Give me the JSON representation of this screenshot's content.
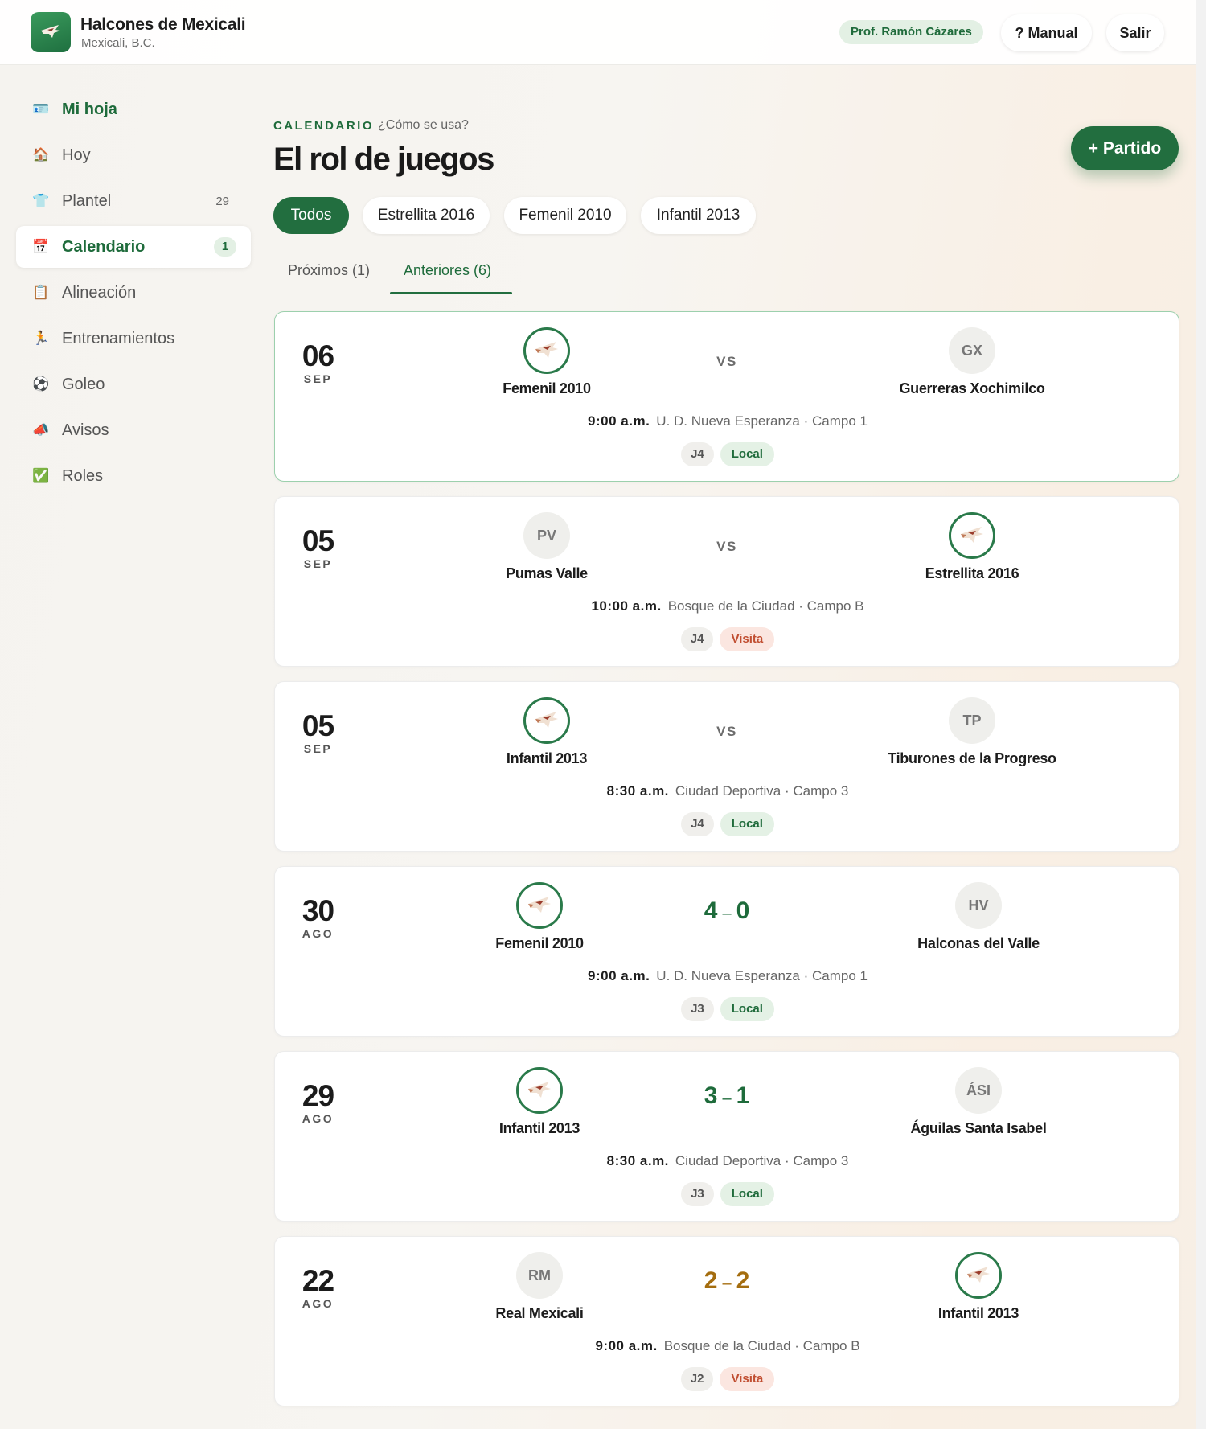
{
  "header": {
    "club_name": "Halcones de Mexicali",
    "club_city": "Mexicali, B.C.",
    "user": "Prof. Ramón Cázares",
    "manual_label": "Manual",
    "manual_icon": "?",
    "logout_label": "Salir"
  },
  "sidebar": {
    "items": [
      {
        "label": "Mi hoja",
        "icon": "id-card-icon",
        "glyph": "🪪"
      },
      {
        "label": "Hoy",
        "icon": "home-icon",
        "glyph": "🏠"
      },
      {
        "label": "Plantel",
        "icon": "shirt-icon",
        "glyph": "👕",
        "count": "29"
      },
      {
        "label": "Calendario",
        "icon": "calendar-icon",
        "glyph": "📅",
        "badge": "1"
      },
      {
        "label": "Alineación",
        "icon": "clipboard-icon",
        "glyph": "📋"
      },
      {
        "label": "Entrenamientos",
        "icon": "runner-icon",
        "glyph": "🏃"
      },
      {
        "label": "Goleo",
        "icon": "ball-icon",
        "glyph": "⚽"
      },
      {
        "label": "Avisos",
        "icon": "megaphone-icon",
        "glyph": "📣"
      },
      {
        "label": "Roles",
        "icon": "check-icon",
        "glyph": "✅"
      }
    ]
  },
  "page": {
    "eyebrow": "CALENDARIO",
    "help": "¿Cómo se usa?",
    "title": "El rol de juegos",
    "add_button": "+ Partido"
  },
  "filters": [
    "Todos",
    "Estrellita 2016",
    "Femenil 2010",
    "Infantil 2013"
  ],
  "tabs": [
    "Próximos (1)",
    "Anteriores (6)"
  ],
  "matches": [
    {
      "day": "06",
      "month": "SEP",
      "home": {
        "name": "Femenil 2010",
        "own": true
      },
      "away": {
        "name": "Guerreras Xochimilco",
        "initials": "GX"
      },
      "center": "VS",
      "time": "9:00 a.m.",
      "venue": "U. D. Nueva Esperanza · Campo 1",
      "round": "J4",
      "side": "Local"
    },
    {
      "day": "05",
      "month": "SEP",
      "home": {
        "name": "Pumas Valle",
        "initials": "PV"
      },
      "away": {
        "name": "Estrellita 2016",
        "own": true
      },
      "center": "VS",
      "time": "10:00 a.m.",
      "venue": "Bosque de la Ciudad · Campo B",
      "round": "J4",
      "side": "Visita"
    },
    {
      "day": "05",
      "month": "SEP",
      "home": {
        "name": "Infantil 2013",
        "own": true
      },
      "away": {
        "name": "Tiburones de la Progreso",
        "initials": "TP"
      },
      "center": "VS",
      "time": "8:30 a.m.",
      "venue": "Ciudad Deportiva · Campo 3",
      "round": "J4",
      "side": "Local"
    },
    {
      "day": "30",
      "month": "AGO",
      "home": {
        "name": "Femenil 2010",
        "own": true
      },
      "away": {
        "name": "Halconas del Valle",
        "initials": "HV"
      },
      "score_home": "4",
      "score_away": "0",
      "result": "win",
      "time": "9:00 a.m.",
      "venue": "U. D. Nueva Esperanza · Campo 1",
      "round": "J3",
      "side": "Local"
    },
    {
      "day": "29",
      "month": "AGO",
      "home": {
        "name": "Infantil 2013",
        "own": true
      },
      "away": {
        "name": "Águilas Santa Isabel",
        "initials": "ÁSI"
      },
      "score_home": "3",
      "score_away": "1",
      "result": "win",
      "time": "8:30 a.m.",
      "venue": "Ciudad Deportiva · Campo 3",
      "round": "J3",
      "side": "Local"
    },
    {
      "day": "22",
      "month": "AGO",
      "home": {
        "name": "Real Mexicali",
        "initials": "RM"
      },
      "away": {
        "name": "Infantil 2013",
        "own": true
      },
      "score_home": "2",
      "score_away": "2",
      "result": "draw",
      "time": "9:00 a.m.",
      "venue": "Bosque de la Ciudad · Campo B",
      "round": "J2",
      "side": "Visita"
    }
  ],
  "colors": {
    "brand": "#226e3f",
    "win": "#1e6b3b",
    "draw": "#a46d0f",
    "visita": "#c14f32"
  }
}
